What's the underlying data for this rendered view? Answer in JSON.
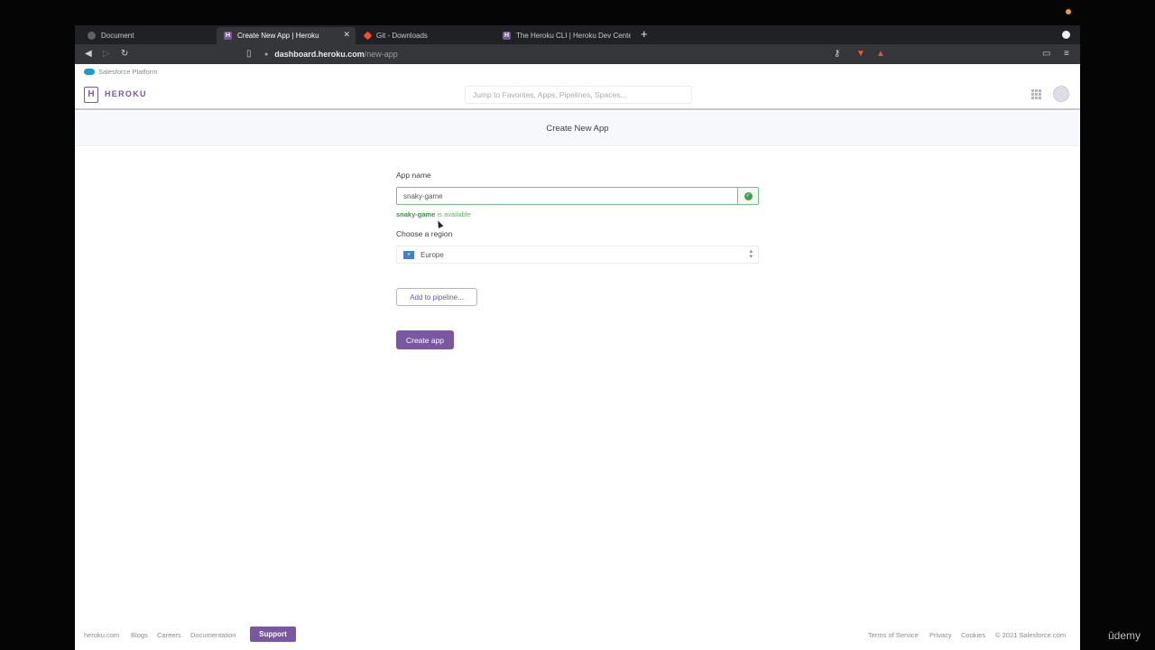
{
  "browser": {
    "tabs": [
      {
        "title": "Document",
        "favicon": "globe-icon",
        "active": false
      },
      {
        "title": "Create New App | Heroku",
        "favicon": "heroku-icon",
        "active": true
      },
      {
        "title": "Git - Downloads",
        "favicon": "git-icon",
        "active": false
      },
      {
        "title": "The Heroku CLI | Heroku Dev Cente",
        "favicon": "heroku-icon",
        "active": false
      }
    ],
    "new_tab_label": "+",
    "address": {
      "domain": "dashboard.heroku.com",
      "path": "/new-app"
    }
  },
  "salesforce_bar": {
    "label": "Salesforce Platform"
  },
  "header": {
    "brand": "HEROKU",
    "logo_letter": "H",
    "search_placeholder": "Jump to Favorites, Apps, Pipelines, Spaces..."
  },
  "page": {
    "title": "Create New App"
  },
  "form": {
    "app_name_label": "App name",
    "app_name_value": "snaky-game",
    "availability_name": "snaky-game",
    "availability_suffix": " is available",
    "region_label": "Choose a region",
    "region_value": "Europe",
    "pipeline_button": "Add to pipeline...",
    "create_button": "Create app"
  },
  "footer": {
    "left_links": [
      "heroku.com",
      "Blogs",
      "Careers",
      "Documentation"
    ],
    "support": "Support",
    "right_links": [
      "Terms of Service",
      "Privacy",
      "Cookies"
    ],
    "copyright": "© 2021 Salesforce.com"
  },
  "watermark": "ûdemy",
  "colors": {
    "heroku_purple": "#79589f",
    "success_green": "#3fa14a",
    "dark_chrome": "#35363a"
  }
}
